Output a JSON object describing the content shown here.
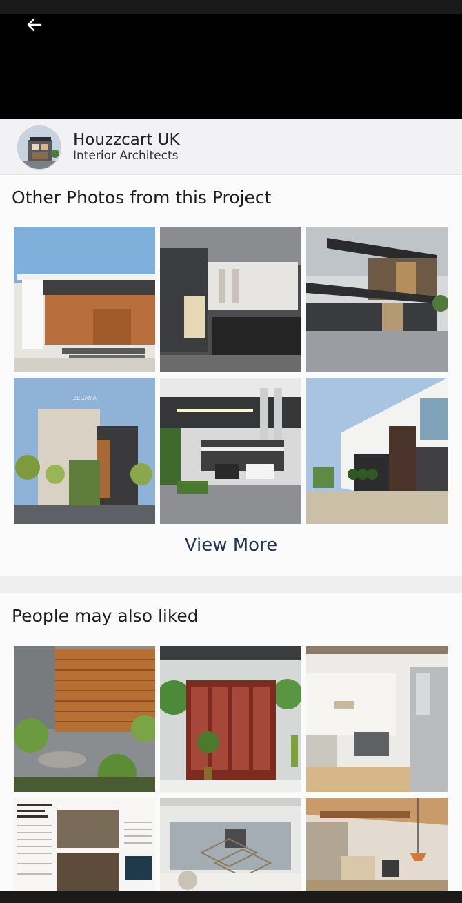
{
  "header": {
    "back_icon": "arrow-left-icon"
  },
  "professional": {
    "name": "Houzzcart UK",
    "role": "Interior Architects",
    "avatar_icon": "house-avatar"
  },
  "project_photos": {
    "title": "Other Photos from this Project",
    "view_more_label": "View More",
    "view_more_color": "#1f3555"
  },
  "liked_photos": {
    "title": "People may also liked"
  },
  "colors": {
    "viewer_background": "#000000",
    "page_background": "#efefef",
    "section_background": "#fbfbfb"
  }
}
